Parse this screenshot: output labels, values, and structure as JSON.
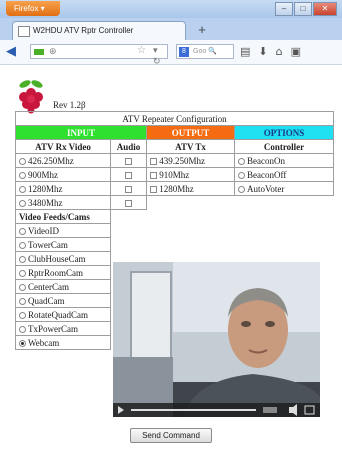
{
  "browser": {
    "app_button": "Firefox",
    "tab_title": "W2HDU ATV Rptr Controller",
    "new_tab": "+",
    "search_placeholder": "Goo",
    "search_engine_letter": "8",
    "window_controls": {
      "minimize": "–",
      "maximize": "□",
      "close": "✕"
    }
  },
  "page": {
    "revision": "Rev 1.2β",
    "table_caption": "ATV Repeater Configuration",
    "headers": {
      "input": "INPUT",
      "output": "OUTPUT",
      "options": "OPTIONS"
    },
    "subheaders": {
      "rx": "ATV Rx Video",
      "audio": "Audio",
      "tx": "ATV Tx",
      "controller": "Controller"
    },
    "rx_freqs": [
      "426.250Mhz",
      "900Mhz",
      "1280Mhz",
      "3480Mhz"
    ],
    "tx_freqs": [
      "439.250Mhz",
      "910Mhz",
      "1280Mhz"
    ],
    "controller": [
      "BeaconOn",
      "BeaconOff",
      "AutoVoter"
    ],
    "feeds_header": "Video Feeds/Cams",
    "feeds": [
      "VideoID",
      "TowerCam",
      "ClubHouseCam",
      "RptrRoomCam",
      "CenterCam",
      "QuadCam",
      "RotateQuadCam",
      "TxPowerCam",
      "Webcam"
    ],
    "selected_feed": "Webcam",
    "send_button": "Send Command"
  },
  "colors": {
    "input": "#2fe02f",
    "output": "#f56b12",
    "options": "#1ee0f0"
  }
}
